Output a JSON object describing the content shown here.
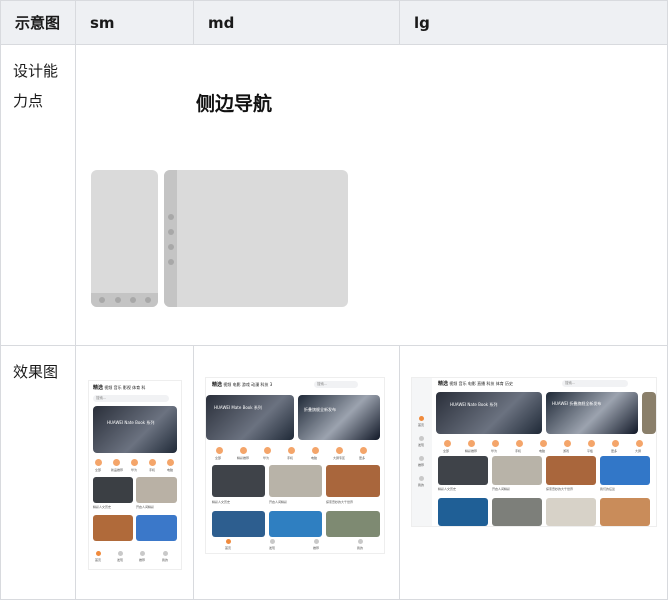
{
  "table": {
    "headers": [
      "示意图",
      "sm",
      "md",
      "lg"
    ],
    "rows": [
      {
        "label": "设计能力点"
      },
      {
        "label": "效果图"
      }
    ]
  },
  "diagram": {
    "title": "侧边导航"
  },
  "preview": {
    "sm": {
      "tabs": [
        "精选",
        "视频",
        "音乐",
        "影视",
        "体育",
        "科"
      ],
      "search": "搜索...",
      "banner_title": "HUAWEI Nate Book 系列",
      "icons": [
        "全部",
        "新品推荐",
        "华为",
        "手机",
        "电脑"
      ],
      "items": [
        "精彩人文历史",
        "开启人间精彩"
      ],
      "nav": [
        "首页",
        "发现",
        "推荐",
        "我的"
      ]
    },
    "md": {
      "tabs": [
        "精选",
        "视频",
        "电影",
        "游戏",
        "动漫",
        "科技",
        "3"
      ],
      "search": "搜索...",
      "banner1": "HUAWEI Mate Book 系列",
      "banner2": "折叠旗舰全新发布",
      "icons": [
        "全部",
        "精彩推荐",
        "华为",
        "手机",
        "电脑",
        "大屏专区",
        "更多"
      ],
      "items": [
        "精彩人文历史",
        "开启人间精彩",
        "探索奇妙的大千世界"
      ],
      "nav": [
        "首页",
        "发现",
        "推荐",
        "我的"
      ]
    },
    "lg": {
      "tabs": [
        "精选",
        "视频",
        "音乐",
        "电影",
        "直播",
        "科技",
        "体育",
        "历史"
      ],
      "search": "搜索...",
      "banner1": "HUAWEI Nate Book 系列",
      "banner2": "HUAWEI 折叠旗舰全新发布",
      "icons": [
        "全部",
        "精彩推荐",
        "华为",
        "手机",
        "电脑",
        "游戏",
        "平板",
        "更多",
        "大屏"
      ],
      "items": [
        "精彩人文历史",
        "开启人间精彩",
        "探索奇妙的大千世界",
        "我们的征途"
      ],
      "side_nav": [
        "首页",
        "发现",
        "推荐",
        "我的"
      ]
    }
  }
}
